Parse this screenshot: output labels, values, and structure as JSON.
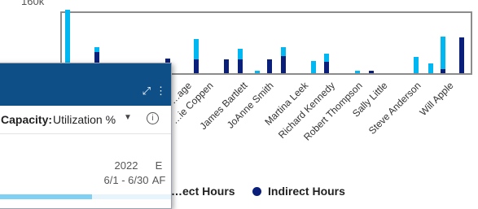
{
  "chart_data": {
    "type": "bar",
    "stacked": true,
    "ytick_label": "160k",
    "categories": [
      "Kaye",
      "Annie Coppen",
      "James Bartlett",
      "JoAnne Smith",
      "Martina Leek",
      "Richard Kennedy",
      "Robert Thompson",
      "Sally Little",
      "Steve Anderson",
      "Will Apple"
    ],
    "visible_labels": [
      "…age",
      "…ie Coppen",
      "James Bartlett",
      "JoAnne Smith",
      "Martina Leek",
      "Richard Kennedy",
      "Robert Thompson",
      "Sally Little",
      "Steve Anderson",
      "Will Apple"
    ],
    "series": [
      {
        "name": "Direct Hours",
        "color": "#00b7f1"
      },
      {
        "name": "Indirect Hours",
        "color": "#0a1f7a"
      }
    ]
  },
  "legend": {
    "direct_label": "…ect Hours",
    "indirect_label": "Indirect Hours"
  },
  "popup": {
    "capacity_label": "Capacity:",
    "capacity_value": "Utilization %",
    "caret": "▼",
    "info": "i",
    "year": "2022",
    "range": "6/1 - 6/30",
    "next_year": "E",
    "next_range": "AF",
    "utilization_fraction": 0.55
  }
}
